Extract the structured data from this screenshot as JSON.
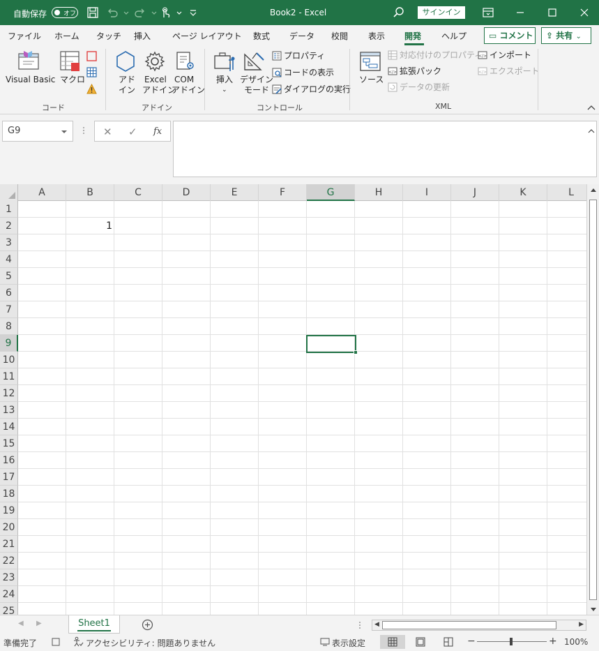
{
  "titlebar": {
    "autosave_label": "自動保存",
    "autosave_state": "オフ",
    "title": "Book2  -  Excel",
    "signin": "サインイン"
  },
  "tabs": [
    "ファイル",
    "ホーム",
    "タッチ",
    "挿入",
    "ページ レイアウト",
    "数式",
    "データ",
    "校閲",
    "表示",
    "開発",
    "ヘルプ"
  ],
  "active_tab": "開発",
  "comment_button": "コメント",
  "share_button": "共有",
  "ribbon": {
    "code": {
      "visual_basic": "Visual Basic",
      "macro": "マクロ",
      "label": "コード"
    },
    "addins": {
      "addin": [
        "アド",
        "イン"
      ],
      "excel_addin": [
        "Excel",
        "アドイン"
      ],
      "com_addin": [
        "COM",
        "アドイン"
      ],
      "label": "アドイン"
    },
    "controls": {
      "insert": "挿入",
      "design_mode": [
        "デザイン",
        "モード"
      ],
      "properties": "プロパティ",
      "view_code": "コードの表示",
      "run_dialog": "ダイアログの実行",
      "label": "コントロール"
    },
    "xml": {
      "source": "ソース",
      "map_properties": "対応付けのプロパティ",
      "expansion_packs": "拡張パック",
      "refresh_data": "データの更新",
      "import": "インポート",
      "export": "エクスポート",
      "label": "XML"
    }
  },
  "formula_bar": {
    "name_box": "G9",
    "fx": "fx",
    "cancel_icon": "✕",
    "enter_icon": "✓",
    "value": ""
  },
  "sheet": {
    "columns": [
      "A",
      "B",
      "C",
      "D",
      "E",
      "F",
      "G",
      "H",
      "I",
      "J",
      "K",
      "L"
    ],
    "rows": [
      "1",
      "2",
      "3",
      "4",
      "5",
      "6",
      "7",
      "8",
      "9",
      "10",
      "11",
      "12",
      "13",
      "14",
      "15",
      "16",
      "17",
      "18",
      "19",
      "20",
      "21",
      "22",
      "23",
      "24",
      "25"
    ],
    "selected_column": "G",
    "selected_row": "9",
    "cells": {
      "B2": "1"
    }
  },
  "sheet_tabs": [
    "Sheet1"
  ],
  "status": {
    "ready": "準備完了",
    "accessibility": "アクセシビリティ: 問題ありません",
    "display_settings": "表示設定",
    "zoom": "100%"
  },
  "colors": {
    "excel_green": "#217346"
  }
}
